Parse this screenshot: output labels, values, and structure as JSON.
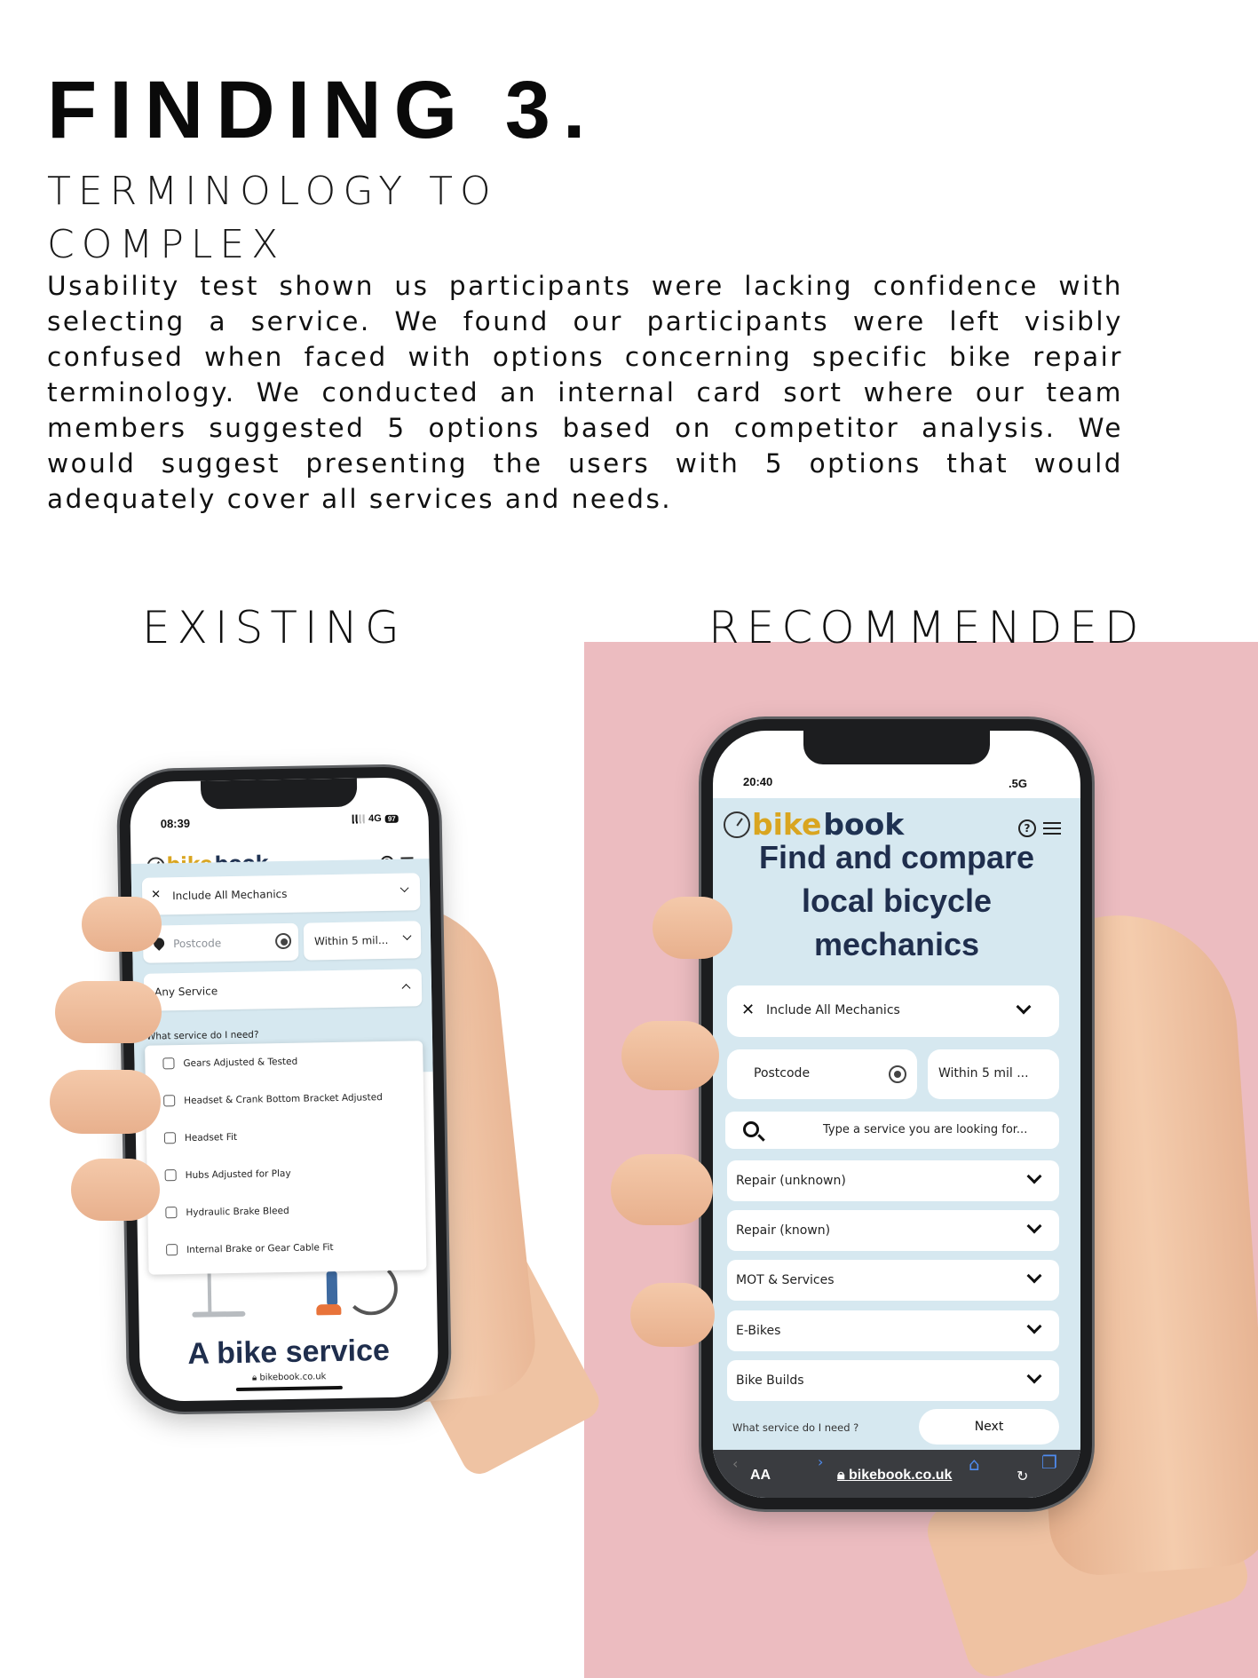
{
  "header": {
    "title": "FINDING 3.",
    "subtitle": "TERMINOLOGY TO COMPLEX",
    "body": "Usability test shown us participants were lacking confidence with selecting a service. We found our participants were left visibly confused when faced with options concerning specific bike repair terminology. We conducted an internal card sort where our team members suggested 5 options based on competitor analysis. We would suggest presenting the users with 5 options that would adequately cover all services and needs."
  },
  "labels": {
    "existing": "EXISTING",
    "recommended": "RECOMMENDED"
  },
  "colors": {
    "pink_panel": "#ecbcc0",
    "screen_bg": "#d6e8f0",
    "brand_bike": "#d9a520",
    "brand_book": "#1f3252"
  },
  "existing_phone": {
    "time": "08:39",
    "network": "4G",
    "battery": "97",
    "brand_bike": "bike",
    "brand_book": "book",
    "mechanics_select": "Include All Mechanics",
    "postcode_placeholder": "Postcode",
    "distance_select": "Within 5 mil...",
    "service_select": "Any Service",
    "service_help": "What service do I need?",
    "options": [
      "Gears Adjusted & Tested",
      "Headset & Crank Bottom Bracket Adjusted",
      "Headset Fit",
      "Hubs Adjusted for Play",
      "Hydraulic Brake Bleed",
      "Internal Brake or Gear Cable Fit"
    ],
    "hero_text": "A bike service",
    "url": "bikebook.co.uk"
  },
  "recommended_phone": {
    "time": "20:40",
    "network": ".5G",
    "brand_bike": "bike",
    "brand_book": "book",
    "headline": "Find and compare local bicycle mechanics",
    "mechanics_select": "Include All Mechanics",
    "postcode_placeholder": "Postcode",
    "distance_select": "Within 5 mil ...",
    "search_placeholder": "Type a service you are looking for...",
    "categories": [
      "Repair (unknown)",
      "Repair (known)",
      "MOT & Services",
      "E-Bikes",
      "Bike Builds"
    ],
    "service_help": "What service do I need ?",
    "next_label": "Next",
    "toolbar_aa": "AA",
    "url": "bikebook.co.uk"
  }
}
